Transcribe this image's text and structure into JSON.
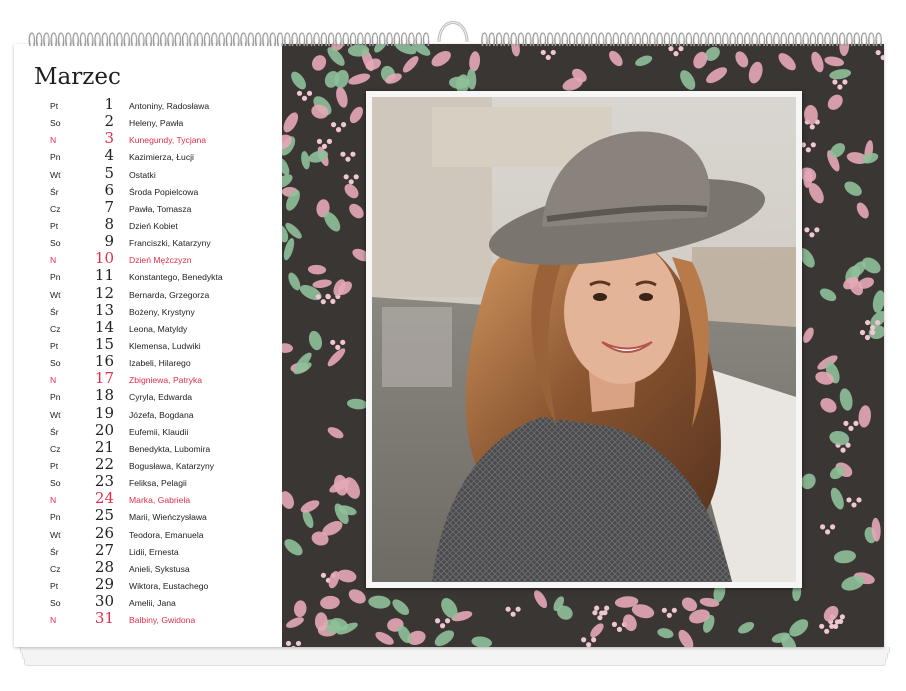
{
  "calendar": {
    "month": "Marzec",
    "days": [
      {
        "dn": "Pt",
        "num": "1",
        "names": "Antoniny, Radosława",
        "sunday": false
      },
      {
        "dn": "So",
        "num": "2",
        "names": "Heleny, Pawła",
        "sunday": false
      },
      {
        "dn": "N",
        "num": "3",
        "names": "Kunegundy, Tycjana",
        "sunday": true
      },
      {
        "dn": "Pn",
        "num": "4",
        "names": "Kazimierza, Łucji",
        "sunday": false
      },
      {
        "dn": "Wt",
        "num": "5",
        "names": "Ostatki",
        "sunday": false
      },
      {
        "dn": "Śr",
        "num": "6",
        "names": "Środa Popielcowa",
        "sunday": false
      },
      {
        "dn": "Cz",
        "num": "7",
        "names": "Pawła, Tomasza",
        "sunday": false
      },
      {
        "dn": "Pt",
        "num": "8",
        "names": "Dzień Kobiet",
        "sunday": false
      },
      {
        "dn": "So",
        "num": "9",
        "names": "Franciszki, Katarzyny",
        "sunday": false
      },
      {
        "dn": "N",
        "num": "10",
        "names": "Dzień Mężczyzn",
        "sunday": true
      },
      {
        "dn": "Pn",
        "num": "11",
        "names": "Konstantego, Benedykta",
        "sunday": false
      },
      {
        "dn": "Wt",
        "num": "12",
        "names": "Bernarda, Grzegorza",
        "sunday": false
      },
      {
        "dn": "Śr",
        "num": "13",
        "names": "Bożeny, Krystyny",
        "sunday": false
      },
      {
        "dn": "Cz",
        "num": "14",
        "names": "Leona, Matyldy",
        "sunday": false
      },
      {
        "dn": "Pt",
        "num": "15",
        "names": "Klemensa, Ludwiki",
        "sunday": false
      },
      {
        "dn": "So",
        "num": "16",
        "names": "Izabeli, Hilarego",
        "sunday": false
      },
      {
        "dn": "N",
        "num": "17",
        "names": "Zbigniewa, Patryka",
        "sunday": true
      },
      {
        "dn": "Pn",
        "num": "18",
        "names": "Cyryla, Edwarda",
        "sunday": false
      },
      {
        "dn": "Wt",
        "num": "19",
        "names": "Józefa, Bogdana",
        "sunday": false
      },
      {
        "dn": "Śr",
        "num": "20",
        "names": "Eufemii, Klaudii",
        "sunday": false
      },
      {
        "dn": "Cz",
        "num": "21",
        "names": "Benedykta, Lubomira",
        "sunday": false
      },
      {
        "dn": "Pt",
        "num": "22",
        "names": "Bogusława, Katarzyny",
        "sunday": false
      },
      {
        "dn": "So",
        "num": "23",
        "names": "Feliksa, Pelagii",
        "sunday": false
      },
      {
        "dn": "N",
        "num": "24",
        "names": "Marka, Gabriela",
        "sunday": true
      },
      {
        "dn": "Pn",
        "num": "25",
        "names": "Marii, Wieńczysława",
        "sunday": false
      },
      {
        "dn": "Wt",
        "num": "26",
        "names": "Teodora, Emanuela",
        "sunday": false
      },
      {
        "dn": "Śr",
        "num": "27",
        "names": "Lidii, Ernesta",
        "sunday": false
      },
      {
        "dn": "Cz",
        "num": "28",
        "names": "Anieli, Sykstusa",
        "sunday": false
      },
      {
        "dn": "Pt",
        "num": "29",
        "names": "Wiktora, Eustachego",
        "sunday": false
      },
      {
        "dn": "So",
        "num": "30",
        "names": "Amelii, Jana",
        "sunday": false
      },
      {
        "dn": "N",
        "num": "31",
        "names": "Balbiny, Gwidona",
        "sunday": true
      }
    ]
  },
  "colors": {
    "sunday": "#e0304b",
    "weekday": "#222222",
    "panel_bg": "#3a3634",
    "leaf_pink": "#e6a9b6",
    "leaf_green": "#8fc09a",
    "berry": "#efc6d2"
  },
  "photo": {
    "subject": "smiling-woman-in-grey-hat-and-tweed-coat"
  }
}
